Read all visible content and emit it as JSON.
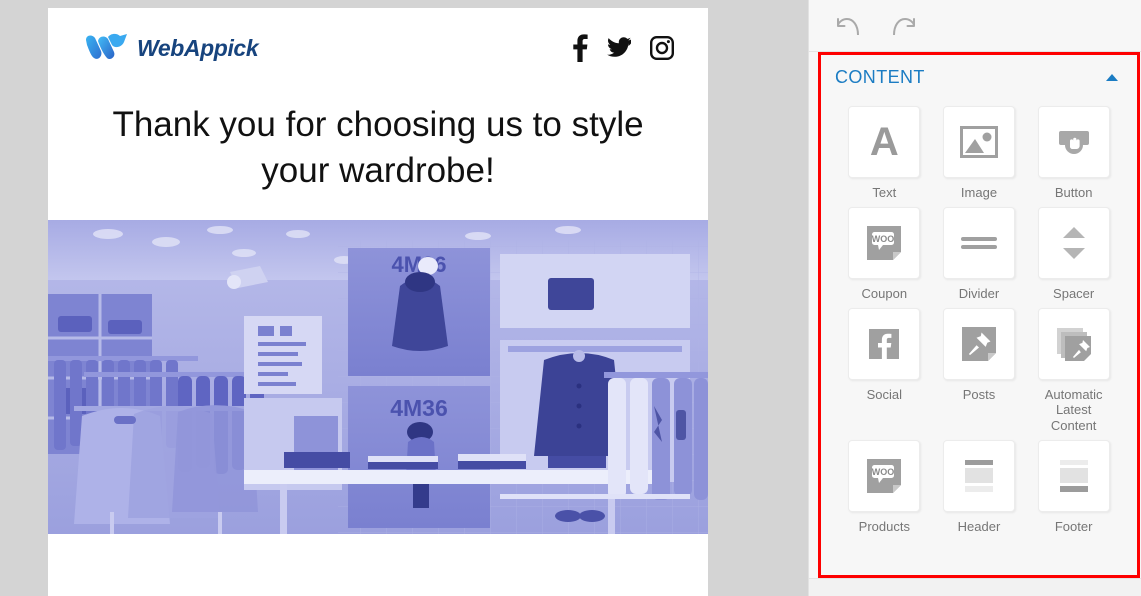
{
  "email": {
    "logo": {
      "brand_name": "WebAppick",
      "mark": "webappick-logo-icon"
    },
    "social": [
      {
        "name": "facebook-icon",
        "label": "Facebook"
      },
      {
        "name": "twitter-icon",
        "label": "Twitter"
      },
      {
        "name": "instagram-icon",
        "label": "Instagram"
      }
    ],
    "headline": "Thank you for choosing us to style your wardrobe!",
    "photo": {
      "alt": "Clothing retail store interior with racks, folded garments and 4M36 posters",
      "poster_text_top": "4M36",
      "poster_text_bottom": "4M36",
      "tint": "#8e93d9"
    }
  },
  "panel": {
    "toolbar": [
      {
        "name": "undo-button",
        "label": "Undo"
      },
      {
        "name": "redo-button",
        "label": "Redo"
      }
    ],
    "section": {
      "title": "CONTENT",
      "collapse_icon": "chevron-up-icon",
      "accent_color": "#1b7cc3",
      "highlight_color": "#fe0000"
    },
    "tiles": [
      {
        "label": "Text",
        "icon": "text-letter-a-icon"
      },
      {
        "label": "Image",
        "icon": "image-placeholder-icon"
      },
      {
        "label": "Button",
        "icon": "button-cursor-icon"
      },
      {
        "label": "Coupon",
        "icon": "woo-coupon-icon"
      },
      {
        "label": "Divider",
        "icon": "divider-lines-icon"
      },
      {
        "label": "Spacer",
        "icon": "spacer-arrows-icon"
      },
      {
        "label": "Social",
        "icon": "facebook-square-icon"
      },
      {
        "label": "Posts",
        "icon": "pin-post-icon"
      },
      {
        "label": "Automatic Latest Content",
        "icon": "stacked-pins-icon"
      },
      {
        "label": "Products",
        "icon": "woo-products-icon"
      },
      {
        "label": "Header",
        "icon": "header-block-icon"
      },
      {
        "label": "Footer",
        "icon": "footer-block-icon"
      }
    ]
  }
}
